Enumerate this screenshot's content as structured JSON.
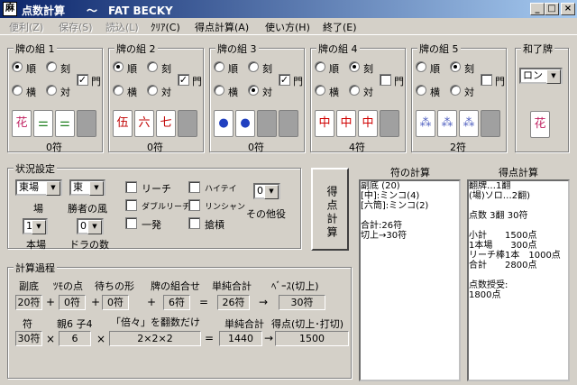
{
  "window": {
    "title": "点数計算　　～　FAT BECKY",
    "icon": "麻"
  },
  "menu": [
    "便利(Z)",
    "保存(S)",
    "読込(L)",
    "ｸﾘｱ(C)",
    "得点計算(A)",
    "使い方(H)",
    "終了(E)"
  ],
  "menu_disabled": [
    true,
    true,
    true,
    false,
    false,
    false,
    false
  ],
  "groups": [
    {
      "title": "牌の組 1",
      "r1": "順",
      "r2": "刻",
      "r3": "横",
      "r4": "対",
      "chk": "門",
      "checked": true,
      "sel": "順",
      "tiles": [
        "花",
        "⚌",
        "⚌"
      ],
      "fu": "0符"
    },
    {
      "title": "牌の組 2",
      "r1": "順",
      "r2": "刻",
      "r3": "横",
      "r4": "対",
      "chk": "門",
      "checked": true,
      "sel": "順",
      "tiles": [
        "伍",
        "六",
        "七"
      ],
      "fu": "0符"
    },
    {
      "title": "牌の組 3",
      "r1": "順",
      "r2": "刻",
      "r3": "横",
      "r4": "対",
      "chk": "門",
      "checked": true,
      "sel": "対",
      "tiles": [
        "●",
        "●"
      ],
      "fu": "0符"
    },
    {
      "title": "牌の組 4",
      "r1": "順",
      "r2": "刻",
      "r3": "横",
      "r4": "対",
      "chk": "門",
      "checked": false,
      "sel": "刻",
      "tiles": [
        "中",
        "中",
        "中"
      ],
      "fu": "4符"
    },
    {
      "title": "牌の組 5",
      "r1": "順",
      "r2": "刻",
      "r3": "横",
      "r4": "対",
      "chk": "門",
      "checked": false,
      "sel": "刻",
      "tiles": [
        "⁂",
        "⁂",
        "⁂"
      ],
      "fu": "2符"
    }
  ],
  "wahai": {
    "title": "和了牌",
    "value": "ロン",
    "tile": "花"
  },
  "status": {
    "title": "状況設定",
    "round": "東場",
    "round_label": "場",
    "wind": "東",
    "wind_label": "勝者の風",
    "honba": "1",
    "honba_label": "本場",
    "dora": "0",
    "dora_label": "ドラの数",
    "riichi": "リーチ",
    "double": "ダブルリーチ",
    "ippatsu": "一発",
    "haitei": "ハイテイ",
    "rinshan": "リンシャン",
    "kakan": "搶槓",
    "other": "0",
    "other_label": "その他役"
  },
  "calc_button": "得点計算",
  "fu_calc": {
    "header": "符の計算",
    "lines": [
      "副底 (20)",
      "[中]:ミンコ(4)",
      "[六筒]:ミンコ(2)",
      "",
      "合計:26符",
      "切上→30符"
    ]
  },
  "score_calc": {
    "header": "得点計算",
    "lines": [
      "翻牌…1翻",
      "(場)ソロ…2翻)",
      "",
      "点数 3翻 30符",
      "",
      "小計　　1500点",
      "1本場　　300点",
      "リーチ棒1本　1000点",
      "合計　　2800点",
      "",
      "点数授受:",
      "1800点"
    ]
  },
  "process": {
    "title": "計算過程",
    "h1": "副底",
    "h2": "ﾂﾓの点",
    "h3": "待ちの形",
    "h4": "牌の組合せ",
    "h5": "単純合計",
    "h6": "ﾍﾞｰｽ(切上)",
    "v1": "20符",
    "v2": "0符",
    "v3": "0符",
    "v4": "6符",
    "v5": "26符",
    "v6": "30符",
    "h7": "符",
    "h8": "親6 子4",
    "h9": "「倍々」を翻数だけ",
    "h10": "単純合計",
    "h11": "得点(切上･打切)",
    "v7": "30符",
    "v8": "6",
    "v9": "2×2×2",
    "v10": "1440",
    "v11": "1500"
  }
}
